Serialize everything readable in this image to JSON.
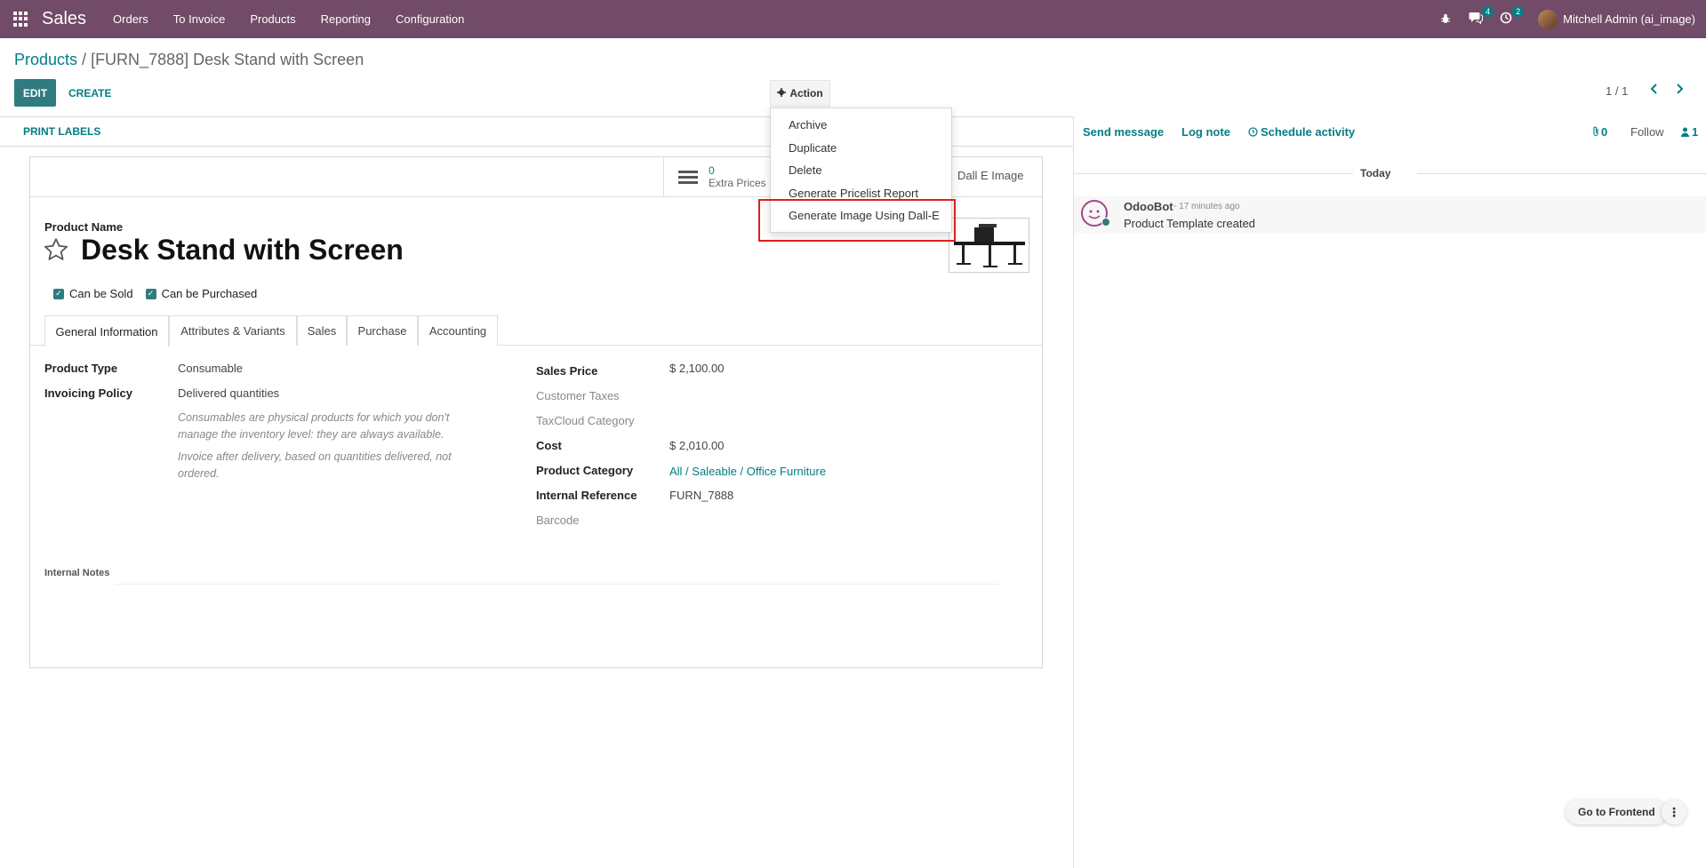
{
  "navbar": {
    "app_name": "Sales",
    "menu": [
      "Orders",
      "To Invoice",
      "Products",
      "Reporting",
      "Configuration"
    ],
    "messages_badge": "4",
    "activities_badge": "2",
    "user_name": "Mitchell Admin (ai_image)",
    "icons": [
      "apps-grid-icon",
      "bug-icon",
      "chat-icon",
      "clock-icon"
    ]
  },
  "breadcrumb": {
    "parent": "Products",
    "separator": " / ",
    "current": "[FURN_7888] Desk Stand with Screen"
  },
  "control": {
    "edit_label": "EDIT",
    "create_label": "CREATE",
    "action_label": "Action",
    "pager": "1 / 1"
  },
  "action_menu": {
    "items": [
      "Archive",
      "Duplicate",
      "Delete",
      "Generate Pricelist Report",
      "Generate Image Using Dall-E"
    ],
    "highlighted_item": "Generate Image Using Dall-E"
  },
  "form_header": {
    "print_labels": "PRINT LABELS"
  },
  "smart_buttons": {
    "extra_prices_value": "0",
    "extra_prices_label": "Extra Prices",
    "dalle_label": "Dall E Image"
  },
  "product": {
    "name_label": "Product Name",
    "name": "Desk Stand with Screen",
    "can_be_sold_label": "Can be Sold",
    "can_be_sold": true,
    "can_be_purchased_label": "Can be Purchased",
    "can_be_purchased": true
  },
  "tabs": [
    "General Information",
    "Attributes & Variants",
    "Sales",
    "Purchase",
    "Accounting"
  ],
  "active_tab": "General Information",
  "general_info": {
    "left": {
      "product_type_label": "Product Type",
      "product_type": "Consumable",
      "invoicing_policy_label": "Invoicing Policy",
      "invoicing_policy": "Delivered quantities",
      "help_consumable": "Consumables are physical products for which you don't manage the inventory level: they are always available.",
      "help_invoice": "Invoice after delivery, based on quantities delivered, not ordered."
    },
    "right": {
      "sales_price_label": "Sales Price",
      "sales_price": "$ 2,100.00",
      "customer_taxes_label": "Customer Taxes",
      "taxcloud_label": "TaxCloud Category",
      "cost_label": "Cost",
      "cost": "$ 2,010.00",
      "category_label": "Product Category",
      "category": "All / Saleable / Office Furniture",
      "internal_ref_label": "Internal Reference",
      "internal_ref": "FURN_7888",
      "barcode_label": "Barcode"
    },
    "internal_notes_label": "Internal Notes"
  },
  "chatter": {
    "send_message": "Send message",
    "log_note": "Log note",
    "schedule_activity": "Schedule activity",
    "attachments_count": "0",
    "follow_label": "Follow",
    "followers_count": "1",
    "today_label": "Today",
    "message": {
      "author": "OdooBot",
      "time": "- 17 minutes ago",
      "body": "Product Template created"
    }
  },
  "floating": {
    "go_to_frontend": "Go to Frontend"
  },
  "colors": {
    "navbar": "#714b67",
    "accent": "#017e84",
    "primary_button": "#2f7b80",
    "highlight": "#e01f1f"
  }
}
